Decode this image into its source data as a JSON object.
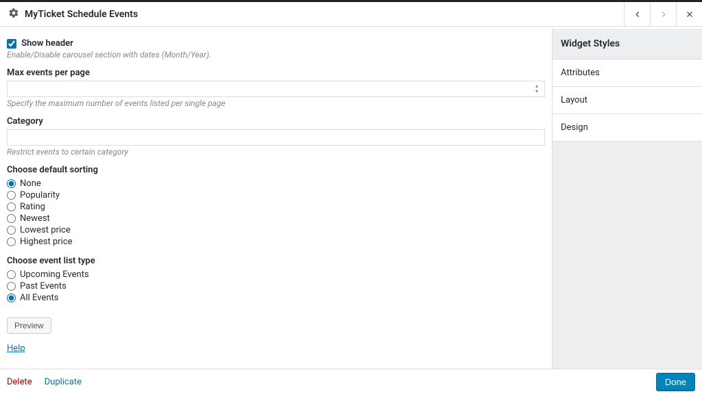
{
  "header": {
    "title": "MyTicket Schedule Events"
  },
  "form": {
    "show_header": {
      "label": "Show header",
      "checked": true,
      "help": "Enable/Disable carousel section with dates (Month/Year)."
    },
    "max_events": {
      "label": "Max events per page",
      "value": "",
      "help": "Specify the maximum number of events listed per single page"
    },
    "category": {
      "label": "Category",
      "value": "",
      "help": "Restrict events to certain category"
    },
    "sorting": {
      "label": "Choose default sorting",
      "options": [
        "None",
        "Popularity",
        "Rating",
        "Newest",
        "Lowest price",
        "Highest price"
      ],
      "selected": "None"
    },
    "list_type": {
      "label": "Choose event list type",
      "options": [
        "Upcoming Events",
        "Past Events",
        "All Events"
      ],
      "selected": "All Events"
    },
    "preview_btn": "Preview",
    "help_link": "Help"
  },
  "sidebar": {
    "header": "Widget Styles",
    "items": [
      "Attributes",
      "Layout",
      "Design"
    ]
  },
  "footer": {
    "delete": "Delete",
    "duplicate": "Duplicate",
    "done": "Done"
  }
}
